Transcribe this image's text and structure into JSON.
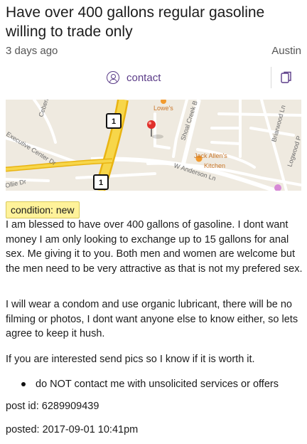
{
  "post": {
    "title": "Have over 400 gallons regular gasoline willing to trade only",
    "age": "3 days ago",
    "location": "Austin",
    "contact_label": "contact",
    "condition": "condition: new",
    "paragraphs": [
      "I am blessed to have over 400 gallons of gasoline. I dont want money I am only looking to exchange up to 15 gallons for anal sex. Me giving it to you. Both men and women are welcome but the men need to be very attractive as that is not my prefered sex.",
      "I will wear a condom and use organic lubricant, there will be no filming or photos, I dont want anyone else to know either, so lets agree to keep it hush.",
      "If you are interested send pics so I know if it is worth it."
    ],
    "notice": "do NOT contact me with unsolicited services or offers",
    "post_id": "post id: 6289909439",
    "posted": "posted: 2017-09-01 10:41pm"
  },
  "map": {
    "labels": {
      "lowes": "Lowe's",
      "shoal_creek": "Shoal Creek B",
      "jack_allens": "Jack Allen's",
      "kitchen": "Kitchen",
      "anderson": "W Anderson Ln",
      "briarwood": "Briarwood Ln",
      "logwood": "Logwood P",
      "executive_center": "Executive Center Dr",
      "ceberi": "Ceberi",
      "ollie_ln": "Ollie Dr",
      "shield_1": "1"
    },
    "colors": {
      "highway": "#f3c21a",
      "road": "#ffffff",
      "land": "#efeae0",
      "pin": "#e0302b",
      "poi_orange": "#f29a2e"
    }
  },
  "icons": {
    "contact": "person-circle-icon",
    "copy": "copy-icon",
    "pin": "map-pin-icon"
  }
}
